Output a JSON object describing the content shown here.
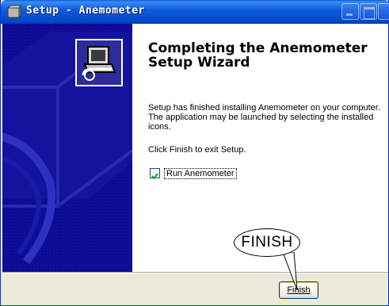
{
  "window": {
    "title": "Setup - Anemometer",
    "title_icon": "setup-box-icon",
    "buttons": [
      "minimize-icon",
      "maximize-icon",
      "close-icon"
    ]
  },
  "main": {
    "heading": "Completing the Anemometer Setup Wizard",
    "paragraph1": "Setup has finished installing Anemometer on your computer. The application may be launched by selecting the installed icons.",
    "paragraph2": "Click Finish to exit Setup.",
    "checkbox_label": "Run Anemometer",
    "checkbox_checked": true
  },
  "footer": {
    "finish_label": "Finish",
    "callout_text": "FINISH"
  },
  "colors": {
    "titlebar": "#0349c9",
    "side_panel": "#0a0a8a",
    "window_bg": "#ece9d8"
  }
}
